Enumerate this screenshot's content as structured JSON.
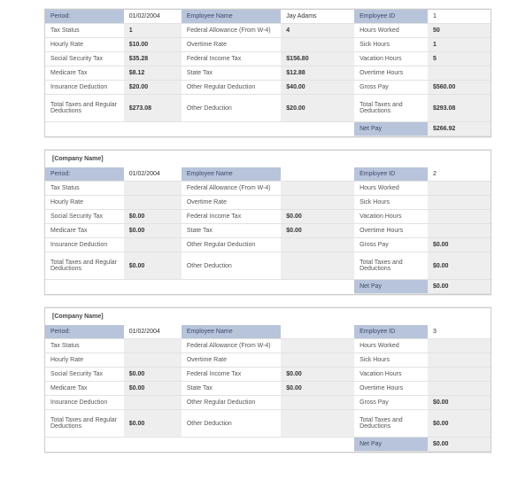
{
  "labels": {
    "period": "Period:",
    "employee_name": "Employee Name",
    "employee_id": "Employee ID",
    "tax_status": "Tax Status",
    "fed_allow": "Federal Allowance (From W-4)",
    "hours_worked": "Hours Worked",
    "hourly_rate": "Hourly Rate",
    "overtime_rate": "Overtime Rate",
    "sick_hours": "Sick Hours",
    "ss_tax": "Social Security Tax",
    "fed_income_tax": "Federal Income Tax",
    "vacation_hours": "Vacation Hours",
    "medicare_tax": "Medicare Tax",
    "state_tax": "State Tax",
    "overtime_hours": "Overtime Hours",
    "ins_deduct": "Insurance Deduction",
    "other_reg_deduct": "Other Regular Deduction",
    "gross_pay": "Gross Pay",
    "total_tax_deduct": "Total Taxes and Regular Deductions",
    "other_deduct": "Other Deduction",
    "total_tax_deduct2": "Total Taxes and Deductions",
    "net_pay": "Net Pay",
    "company_placeholder": "[Company Name]"
  },
  "stubs": [
    {
      "company": "",
      "period": "01/02/2004",
      "employee_name": "Jay Adams",
      "employee_id": "1",
      "tax_status": "1",
      "fed_allow": "4",
      "hours_worked": "50",
      "hourly_rate": "$10.00",
      "overtime_rate": "",
      "sick_hours": "1",
      "ss_tax": "$35.28",
      "fed_income_tax": "$156.80",
      "vacation_hours": "5",
      "medicare_tax": "$8.12",
      "state_tax": "$12.88",
      "overtime_hours": "",
      "ins_deduct": "$20.00",
      "other_reg_deduct": "$40.00",
      "gross_pay": "$560.00",
      "total_tax_deduct": "$273.08",
      "other_deduct": "$20.00",
      "total_tax_deduct2": "$293.08",
      "net_pay": "$266.92"
    },
    {
      "company": "[Company Name]",
      "period": "01/02/2004",
      "employee_name": "",
      "employee_id": "2",
      "tax_status": "",
      "fed_allow": "",
      "hours_worked": "",
      "hourly_rate": "",
      "overtime_rate": "",
      "sick_hours": "",
      "ss_tax": "$0.00",
      "fed_income_tax": "$0.00",
      "vacation_hours": "",
      "medicare_tax": "$0.00",
      "state_tax": "$0.00",
      "overtime_hours": "",
      "ins_deduct": "",
      "other_reg_deduct": "",
      "gross_pay": "$0.00",
      "total_tax_deduct": "$0.00",
      "other_deduct": "",
      "total_tax_deduct2": "$0.00",
      "net_pay": "$0.00"
    },
    {
      "company": "[Company Name]",
      "period": "01/02/2004",
      "employee_name": "",
      "employee_id": "3",
      "tax_status": "",
      "fed_allow": "",
      "hours_worked": "",
      "hourly_rate": "",
      "overtime_rate": "",
      "sick_hours": "",
      "ss_tax": "$0.00",
      "fed_income_tax": "$0.00",
      "vacation_hours": "",
      "medicare_tax": "$0.00",
      "state_tax": "$0.00",
      "overtime_hours": "",
      "ins_deduct": "",
      "other_reg_deduct": "",
      "gross_pay": "$0.00",
      "total_tax_deduct": "$0.00",
      "other_deduct": "",
      "total_tax_deduct2": "$0.00",
      "net_pay": "$0.00"
    }
  ]
}
